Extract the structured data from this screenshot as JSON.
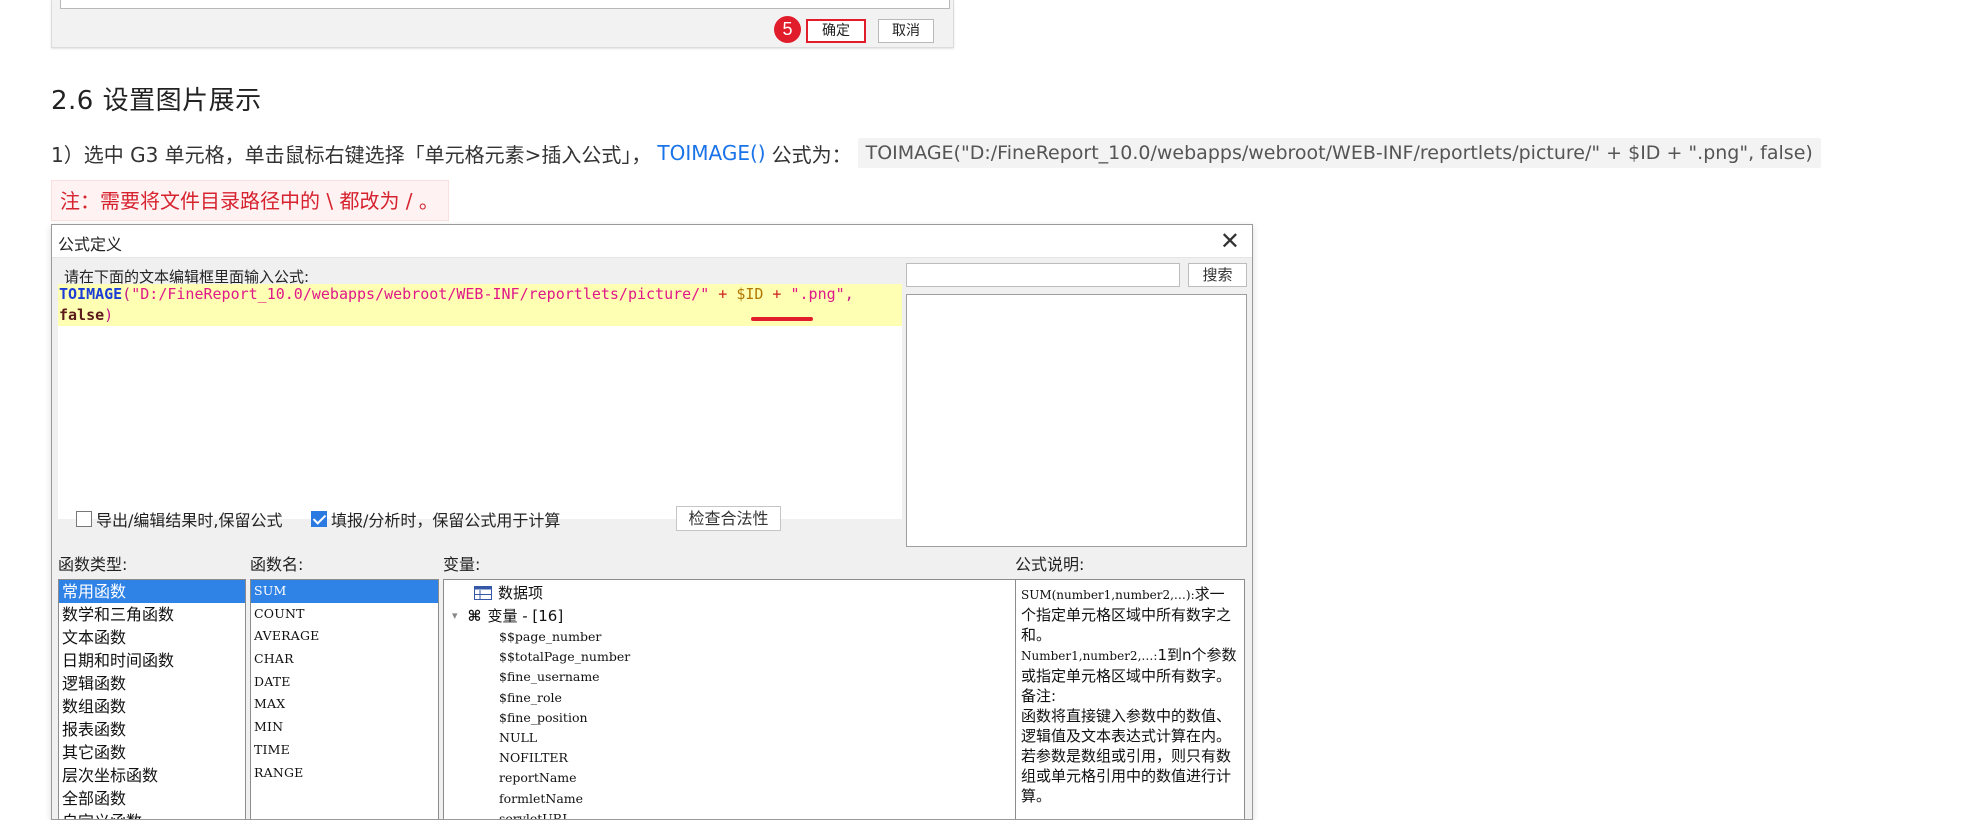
{
  "prev_dialog": {
    "step_badge": "5",
    "ok_label": "确定",
    "cancel_label": "取消"
  },
  "doc": {
    "section_title": "2.6 设置图片展示",
    "step1_prefix": "1）选中 G3 单元格，单击鼠标右键选择「单元格元素>插入公式」，",
    "step1_link": "TOIMAGE()",
    "step1_suffix": "公式为：",
    "step1_code": "TOIMAGE(\"D:/FineReport_10.0/webapps/webroot/WEB-INF/reportlets/picture/\" + $ID + \".png\", false)",
    "note": "注：需要将文件目录路径中的 \\ 都改为 / 。"
  },
  "dialog": {
    "title": "公式定义",
    "editor_label": "请在下面的文本编辑框里面输入公式:",
    "code": {
      "fn": "TOIMAGE",
      "paren_open": "(",
      "path": "\"D:/FineReport_10.0/webapps/webroot/WEB-INF/reportlets/picture/\"",
      "plus1": " + ",
      "var": "$ID",
      "plus2": " + ",
      "ext": "\".png\"",
      "comma": ",",
      "kw": "false",
      "paren_close": ")"
    },
    "search_placeholder": "",
    "search_button": "搜索",
    "option1": "导出/编辑结果时,保留公式",
    "option1_checked": false,
    "option2": "填报/分析时，保留公式用于计算",
    "option2_checked": true,
    "check_button": "检查合法性",
    "labels": {
      "fn_type": "函数类型:",
      "fn_name": "函数名:",
      "variables": "变量:",
      "description": "公式说明:"
    },
    "fn_types": [
      "常用函数",
      "数学和三角函数",
      "文本函数",
      "日期和时间函数",
      "逻辑函数",
      "数组函数",
      "报表函数",
      "其它函数",
      "层次坐标函数",
      "全部函数",
      "自定义函数"
    ],
    "fn_names": [
      "SUM",
      "COUNT",
      "AVERAGE",
      "CHAR",
      "DATE",
      "MAX",
      "MIN",
      "TIME",
      "RANGE"
    ],
    "variables_tree": {
      "data_item": "数据项",
      "var_group": "变量 - [16]",
      "vars": [
        "$$page_number",
        "$$totalPage_number",
        "$fine_username",
        "$fine_role",
        "$fine_position",
        "NULL",
        "NOFILTER",
        "reportName",
        "formletName",
        "servletURL"
      ]
    },
    "description": {
      "sig": "SUM(number1,number2,…):",
      "sig_text": "求一个指定单元格区域中所有数字之和。",
      "params": "Number1,number2,…:",
      "params_text": "1到n个参数或指定单元格区域中所有数字。",
      "note_label": "备注:",
      "note_text": "函数将直接键入参数中的数值、逻辑值及文本表达式计算在内。若参数是数组或引用，则只有数组或单元格引用中的数值进行计算。"
    },
    "colors": {
      "selection": "#2f82e6",
      "code_highlight": "#ffffb3",
      "red_mark": "#e11d2b"
    }
  }
}
